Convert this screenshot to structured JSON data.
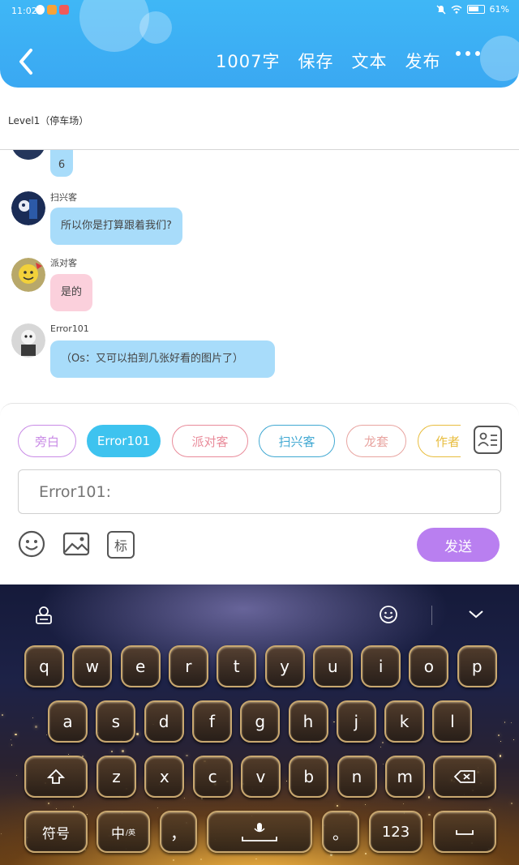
{
  "status_bar": {
    "time": "11:02",
    "battery": "61%"
  },
  "header": {
    "word_count": "1007字",
    "save_label": "保存",
    "text_label": "文本",
    "publish_label": "发布"
  },
  "level": {
    "title": "Level1（停车场）"
  },
  "messages": [
    {
      "name": "",
      "text": "6",
      "color": "blue"
    },
    {
      "name": "扫兴客",
      "text": "所以你是打算跟着我们?",
      "color": "blue"
    },
    {
      "name": "派对客",
      "text": "是的",
      "color": "pink"
    },
    {
      "name": "Error101",
      "text": "（Os：又可以拍到几张好看的图片了）",
      "color": "blue"
    }
  ],
  "characters": [
    {
      "label": "旁白",
      "color": "#c98be6",
      "active": false
    },
    {
      "label": "Error101",
      "color": "#3ec3ef",
      "active": true
    },
    {
      "label": "派对客",
      "color": "#e98b9a",
      "active": false
    },
    {
      "label": "扫兴客",
      "color": "#40a8d2",
      "active": false
    },
    {
      "label": "龙套",
      "color": "#e8a4a0",
      "active": false
    },
    {
      "label": "作者",
      "color": "#e8bd3e",
      "active": false
    }
  ],
  "input": {
    "placeholder": "Error101:"
  },
  "tools": {
    "mark_label": "标",
    "send_label": "发送"
  },
  "keyboard": {
    "row1": [
      "q",
      "w",
      "e",
      "r",
      "t",
      "y",
      "u",
      "i",
      "o",
      "p"
    ],
    "row2": [
      "a",
      "s",
      "d",
      "f",
      "g",
      "h",
      "j",
      "k",
      "l"
    ],
    "row3": [
      "z",
      "x",
      "c",
      "v",
      "b",
      "n",
      "m"
    ],
    "symbols_label": "符号",
    "lang_main": "中",
    "lang_sub": "/英",
    "comma": "，",
    "period": "。",
    "numbers_label": "123"
  }
}
